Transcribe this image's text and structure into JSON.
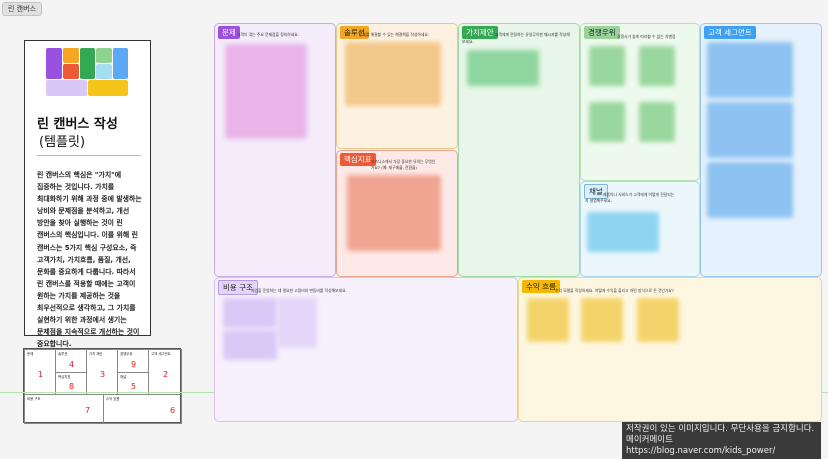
{
  "board_label": "린 캔버스",
  "template_card": {
    "title": "린 캔버스 작성",
    "subtitle": "(템플릿)",
    "description": "린 캔버스의 핵심은 \"가치\"에 집중하는 것입니다. 가치를 최대화하기 위해 과정 중에 발생하는 낭비와 문제점을 분석하고, 개선 방안을 찾아 실행하는 것이 린 캔버스의 핵심입니다. 이를 위해 린 캔버스는 5가지 핵심 구성요소, 즉 고객가치, 가치흐름, 품질, 개선, 문화를 중요하게 다룹니다. 따라서 린 캔버스를 적용할 때에는 고객이 원하는 가치를 제공하는 것을 최우선적으로 생각하고, 그 가치를 실현하기 위한 과정에서 생기는 문제점을 지속적으로 개선하는 것이 중요합니다."
  },
  "mini_canvas": {
    "cells": [
      {
        "label": "문제",
        "number": "1"
      },
      {
        "label": "솔루션",
        "number": "4"
      },
      {
        "label": "가치 제안",
        "number": "3"
      },
      {
        "label": "경쟁우위",
        "number": "9"
      },
      {
        "label": "고객 세그먼트",
        "number": "2"
      },
      {
        "label": "핵심지표",
        "number": "8"
      },
      {
        "label": "채널",
        "number": "5"
      },
      {
        "label": "비용 구조",
        "number": "7"
      },
      {
        "label": "수익 흐름",
        "number": "6"
      }
    ]
  },
  "sections": {
    "problem": {
      "tag": "문제",
      "hint": "고객이 겪는 주요 문제점을 정의하세요."
    },
    "solution": {
      "tag": "솔루션",
      "hint": "문제를 해결할 수 있는 해결책을 작성하세요."
    },
    "key_metrics": {
      "tag": "핵심지표",
      "hint": "비즈니스에서 가장 중요한 유의는 무엇인",
      "hint2": "가요? (예: 재구매율, 전환율)"
    },
    "value_proposition": {
      "tag": "가치제안",
      "hint": "고객에게 전달하는 유일무이한 메시지를 작성해",
      "hint2": "보세요."
    },
    "unfair_advantage": {
      "tag": "경쟁우위",
      "hint": "경쟁사가 쉽게 따라할 수 없는 차별점"
    },
    "channels": {
      "tag": "채널",
      "hint": "제품이나 서비스가 고객에게 어떻게 전달되는",
      "hint2": "지 설명해주세요."
    },
    "customer_segments": {
      "tag": "고객 세그먼트",
      "hint": ""
    },
    "cost_structure": {
      "tag": "비용 구조",
      "hint": "사업을 운영하는 데 필요한 고정비와 변동비를 작성해보세요."
    },
    "revenue_streams": {
      "tag": "수익 흐름",
      "hint": "수익 모델을 작성하세요. 어떻게 수익을 올리고 어떤 방식으로 돈 것인가요?"
    }
  },
  "colors": {
    "problem_bg": "#f4ecfb",
    "problem_border": "#c9a8ee",
    "problem_tag": "#9b51e0",
    "solution_bg": "#fdf2e2",
    "solution_border": "#f0c58a",
    "solution_tag": "#f5a623",
    "metrics_bg": "#fde9e5",
    "metrics_border": "#eba393",
    "metrics_tag": "#ee5a36",
    "value_bg": "#e7f6e8",
    "value_border": "#a3d9a7",
    "value_tag": "#34a853",
    "advantage_bg": "#eef9ee",
    "advantage_border": "#b8e0b8",
    "advantage_tag": "#7ac37a",
    "channel_bg": "#ebf7fb",
    "channel_border": "#a9d9ea",
    "channel_tag": "#d8eef8",
    "segment_bg": "#e5f1fc",
    "segment_border": "#9bc8f0",
    "segment_tag": "#3da0f5",
    "cost_bg": "#f6f1fd",
    "cost_border": "#d7c3f0",
    "cost_tag": "#e3d4f8",
    "revenue_bg": "#fdf7e2",
    "revenue_border": "#efd68c",
    "revenue_tag": "#f5b800"
  },
  "watermark": {
    "line1": "저작권이 있는 이미지입니다. 무단사용을 금지합니다.",
    "line2": "메이커메이트 https://blog.naver.com/kids_power/"
  }
}
